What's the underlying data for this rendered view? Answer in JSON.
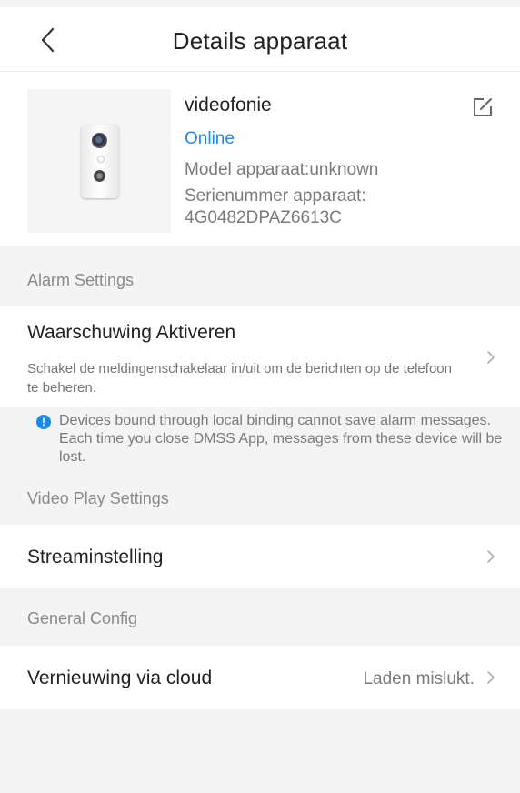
{
  "header": {
    "title": "Details apparaat",
    "back_icon": "chevron-left-icon"
  },
  "device": {
    "name": "videofonie",
    "status": "Online",
    "status_color": "#1e88e5",
    "model": "Model apparaat:unknown",
    "serial_label": "Serienummer apparaat:",
    "serial_value": "4G0482DPAZ6613C",
    "edit_icon": "edit-icon"
  },
  "sections": {
    "alarm": "Alarm Settings",
    "video": "Video Play Settings",
    "general": "General Config"
  },
  "alarm_row": {
    "title": "Waarschuwing Aktiveren",
    "subtitle": "Schakel de meldingenschakelaar in/uit om de berichten op de telefoon te beheren."
  },
  "notice": {
    "icon": "info-icon",
    "icon_glyph": "!",
    "text": "Devices bound through local binding cannot save alarm messages. Each time you close DMSS App, messages from these device will be lost."
  },
  "stream_row": {
    "title": "Streaminstelling"
  },
  "cloud_row": {
    "title": "Vernieuwing via cloud",
    "value": "Laden mislukt."
  },
  "colors": {
    "accent": "#1e88e5",
    "background": "#f4f4f4",
    "card": "#ffffff"
  }
}
